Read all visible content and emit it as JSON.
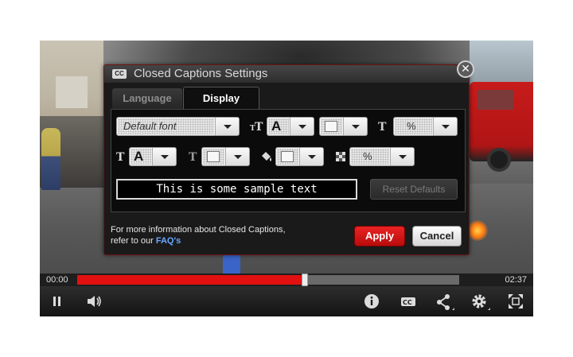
{
  "dialog": {
    "badge": "CC",
    "title": "Closed Captions Settings",
    "close_glyph": "✕",
    "tabs": [
      {
        "label": "Language",
        "active": false
      },
      {
        "label": "Display",
        "active": true
      }
    ],
    "display": {
      "font_select": "Default font",
      "font_size_select": "A",
      "font_color_select": "",
      "font_opacity_select": "%",
      "edge_style_select": "A",
      "edge_color_select": "",
      "background_color_select": "",
      "background_opacity_select": "%"
    },
    "sample_text": "This is some sample text",
    "reset_label": "Reset Defaults",
    "info_line1": "For more information about Closed Captions,",
    "info_line2_prefix": "refer to our ",
    "faq_link": "FAQ's",
    "apply_label": "Apply",
    "cancel_label": "Cancel"
  },
  "player": {
    "time_current": "00:00",
    "time_total": "02:37",
    "progress_fraction": 0.595,
    "icons": [
      "pause-icon",
      "volume-icon",
      "info-icon",
      "cc-icon",
      "share-icon",
      "settings-icon",
      "fullscreen-icon"
    ]
  },
  "colors": {
    "accent_red": "#e21010",
    "apply_red": "#d11414",
    "faq_link": "#6aa9ff"
  }
}
